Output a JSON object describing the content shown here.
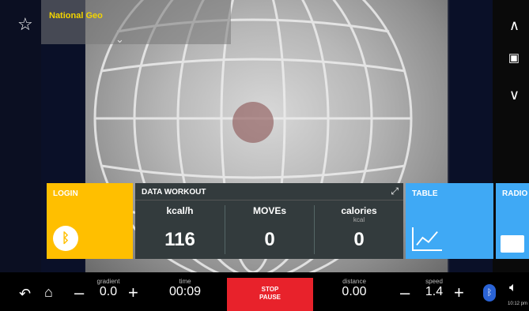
{
  "header": {
    "brand": "National Geo"
  },
  "tiles": {
    "login": {
      "title": "LOGIN"
    },
    "workout": {
      "title": "DATA WORKOUT",
      "columns": [
        {
          "label": "kcal/h",
          "unit": "",
          "value": "116"
        },
        {
          "label": "MOVEs",
          "unit": "",
          "value": "0"
        },
        {
          "label": "calories",
          "unit": "kcal",
          "value": "0"
        }
      ]
    },
    "table": {
      "title": "TABLE"
    },
    "radio": {
      "title": "RADIO"
    }
  },
  "bottom": {
    "gradient": {
      "label": "gradient",
      "value": "0.0"
    },
    "time": {
      "label": "time",
      "value": "00:09"
    },
    "stop": {
      "line1": "STOP",
      "line2": "PAUSE"
    },
    "distance": {
      "label": "distance",
      "value": "0.00"
    },
    "speed": {
      "label": "speed",
      "value": "1.4"
    },
    "clock": "10:12 pm"
  },
  "colors": {
    "login": "#ffbf00",
    "table": "#3fa9f5",
    "stop": "#e8222b",
    "brand": "#f2d400"
  },
  "icons": [
    "star-icon",
    "chevron-up-icon",
    "screen-icon",
    "chevron-down-icon",
    "bluetooth-icon",
    "chart-icon",
    "radio-icon",
    "expand-icon",
    "back-icon",
    "home-icon",
    "volume-icon"
  ]
}
